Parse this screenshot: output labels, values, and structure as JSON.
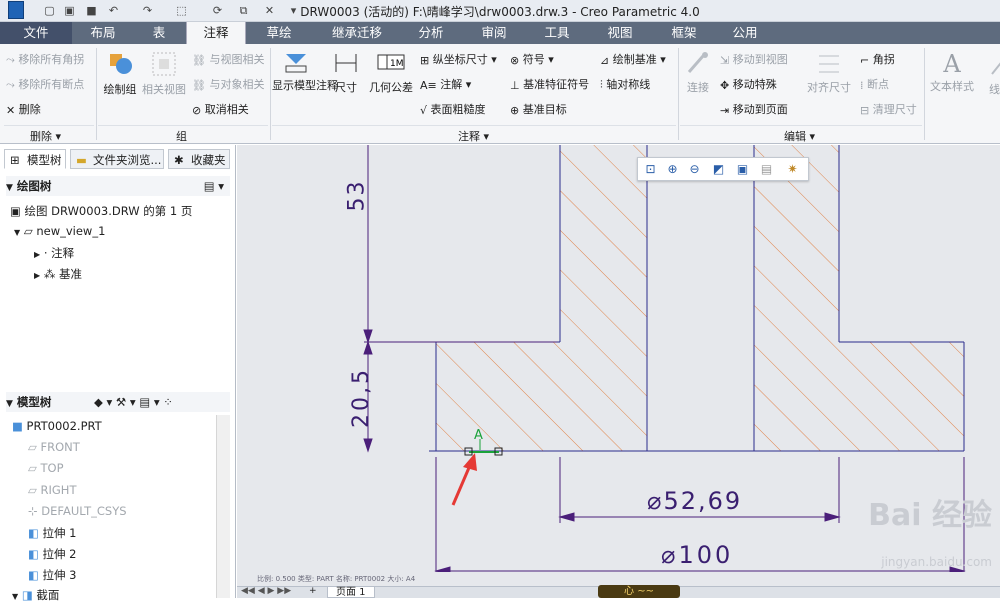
{
  "window": {
    "title": "DRW0003 (活动的) F:\\晴峰学习\\drw0003.drw.3 - Creo Parametric 4.0"
  },
  "tabs": [
    "文件",
    "布局",
    "表",
    "注释",
    "草绘",
    "继承迁移",
    "分析",
    "审阅",
    "工具",
    "视图",
    "框架",
    "公用"
  ],
  "active_tab": "注释",
  "ribbon": {
    "delete_group": {
      "items": [
        "移除所有角拐",
        "移除所有断点",
        "删除"
      ],
      "label": "删除"
    },
    "group_group": {
      "items": [
        "绘制组",
        "相关视图",
        "与视图相关",
        "与对象相关",
        "取消相关"
      ],
      "label": "组"
    },
    "annotate_group": {
      "items": [
        "显示模型注释",
        "尺寸",
        "几何公差",
        "纵坐标尺寸",
        "注解",
        "表面粗糙度",
        "符号",
        "基准特征符号",
        "基准目标",
        "绘制基准",
        "轴对称线"
      ],
      "label": "注释"
    },
    "edit_group": {
      "items": [
        "连接",
        "移动到视图",
        "移动特殊",
        "移动到页面",
        "对齐尺寸",
        "角拐",
        "断点",
        "清理尺寸"
      ],
      "label": "编辑"
    },
    "format_group": {
      "items": [
        "文本样式",
        "线型"
      ]
    }
  },
  "left_panel": {
    "tabs": [
      "模型树",
      "文件夹浏览...",
      "收藏夹"
    ],
    "drawing_tree": {
      "header": "绘图树",
      "items": [
        "绘图 DRW0003.DRW 的第 1 页",
        "new_view_1",
        "注释",
        "基准"
      ]
    },
    "model_tree": {
      "header": "模型树",
      "items": [
        "PRT0002.PRT",
        "FRONT",
        "TOP",
        "RIGHT",
        "DEFAULT_CSYS",
        "拉伸 1",
        "拉伸 2",
        "拉伸 3",
        "截面"
      ]
    }
  },
  "drawing": {
    "dims": {
      "top_height": "53",
      "step_height": "20,5",
      "inner_dia": "⌀52,69",
      "outer_dia": "⌀100"
    },
    "datum_label": "A",
    "status_strip": "比例: 0.500   类型: PART   名称: PRT0002   大小: A4"
  },
  "bottom": {
    "page_tab": "页面 1"
  },
  "floating_badge": "心 ~~",
  "watermark": {
    "text": "Bai 经验",
    "url": "jingyan.baidu.com"
  },
  "colors": {
    "tab_bar": "#5e6b7e",
    "dim_line": "#4b1f7a",
    "hatch": "#e0844a",
    "arrow_red": "#e53935",
    "datum_green": "#1aa23a"
  }
}
